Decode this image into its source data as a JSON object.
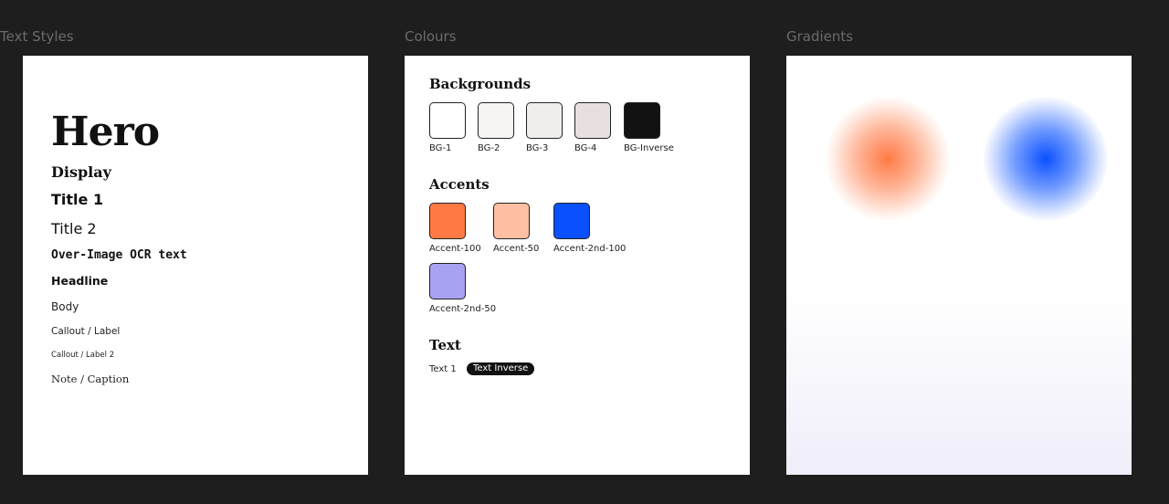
{
  "frames": {
    "text_styles_title": "Text Styles",
    "colours_title": "Colours",
    "gradients_title": "Gradients"
  },
  "text_styles": {
    "hero": "Hero",
    "display": "Display",
    "title1": "Title 1",
    "title2": "Title 2",
    "ocr": "Over-Image OCR text",
    "headline": "Headline",
    "body": "Body",
    "callout": "Callout / Label",
    "callout2": "Callout / Label 2",
    "note": "Note / Caption"
  },
  "colours": {
    "backgrounds_title": "Backgrounds",
    "backgrounds": [
      {
        "label": "BG-1",
        "color": "#ffffff"
      },
      {
        "label": "BG-2",
        "color": "#f6f5f1"
      },
      {
        "label": "BG-3",
        "color": "#efeeea"
      },
      {
        "label": "BG-4",
        "color": "#e8e0de"
      },
      {
        "label": "BG-Inverse",
        "color": "#121212"
      }
    ],
    "accents_title": "Accents",
    "accents": [
      {
        "label": "Accent-100",
        "color": "#ff7a45"
      },
      {
        "label": "Accent-50",
        "color": "#ffbfa3"
      },
      {
        "label": "Accent-2nd-100",
        "color": "#0a50ff"
      },
      {
        "label": "Accent-2nd-50",
        "color": "#a8a2f2"
      }
    ],
    "text_title": "Text",
    "text_1": "Text 1",
    "text_inverse": "Text Inverse"
  },
  "gradients": {
    "orange": "#ff7a45",
    "blue": "#0a50ff",
    "fade_end": "#efeefa"
  }
}
